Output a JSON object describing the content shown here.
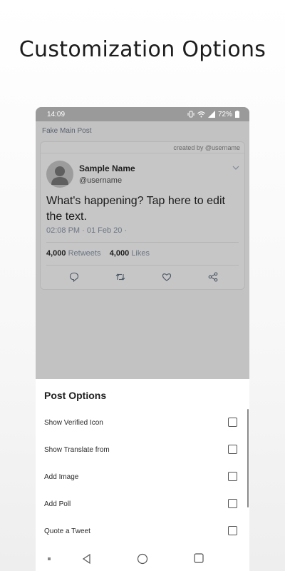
{
  "headline": "Customization Options",
  "status_bar": {
    "time": "14:09",
    "battery": "72%"
  },
  "app": {
    "title": "Fake Main Post"
  },
  "post": {
    "created_by": "created by @username",
    "name": "Sample Name",
    "handle": "@username",
    "text": "What's happening? Tap here to edit the text.",
    "timestamp": "02:08 PM · 01 Feb 20 ·",
    "retweets_count": "4,000",
    "retweets_label": "Retweets",
    "likes_count": "4,000",
    "likes_label": "Likes"
  },
  "sheet": {
    "title": "Post Options",
    "options": [
      {
        "label": "Show Verified Icon",
        "checked": false
      },
      {
        "label": "Show Translate from",
        "checked": false
      },
      {
        "label": "Add Image",
        "checked": false
      },
      {
        "label": "Add Poll",
        "checked": false
      },
      {
        "label": "Quote a Tweet",
        "checked": false
      }
    ]
  },
  "icons": {
    "reply": "reply-icon",
    "retweet": "retweet-icon",
    "like": "heart-icon",
    "share": "share-icon"
  }
}
